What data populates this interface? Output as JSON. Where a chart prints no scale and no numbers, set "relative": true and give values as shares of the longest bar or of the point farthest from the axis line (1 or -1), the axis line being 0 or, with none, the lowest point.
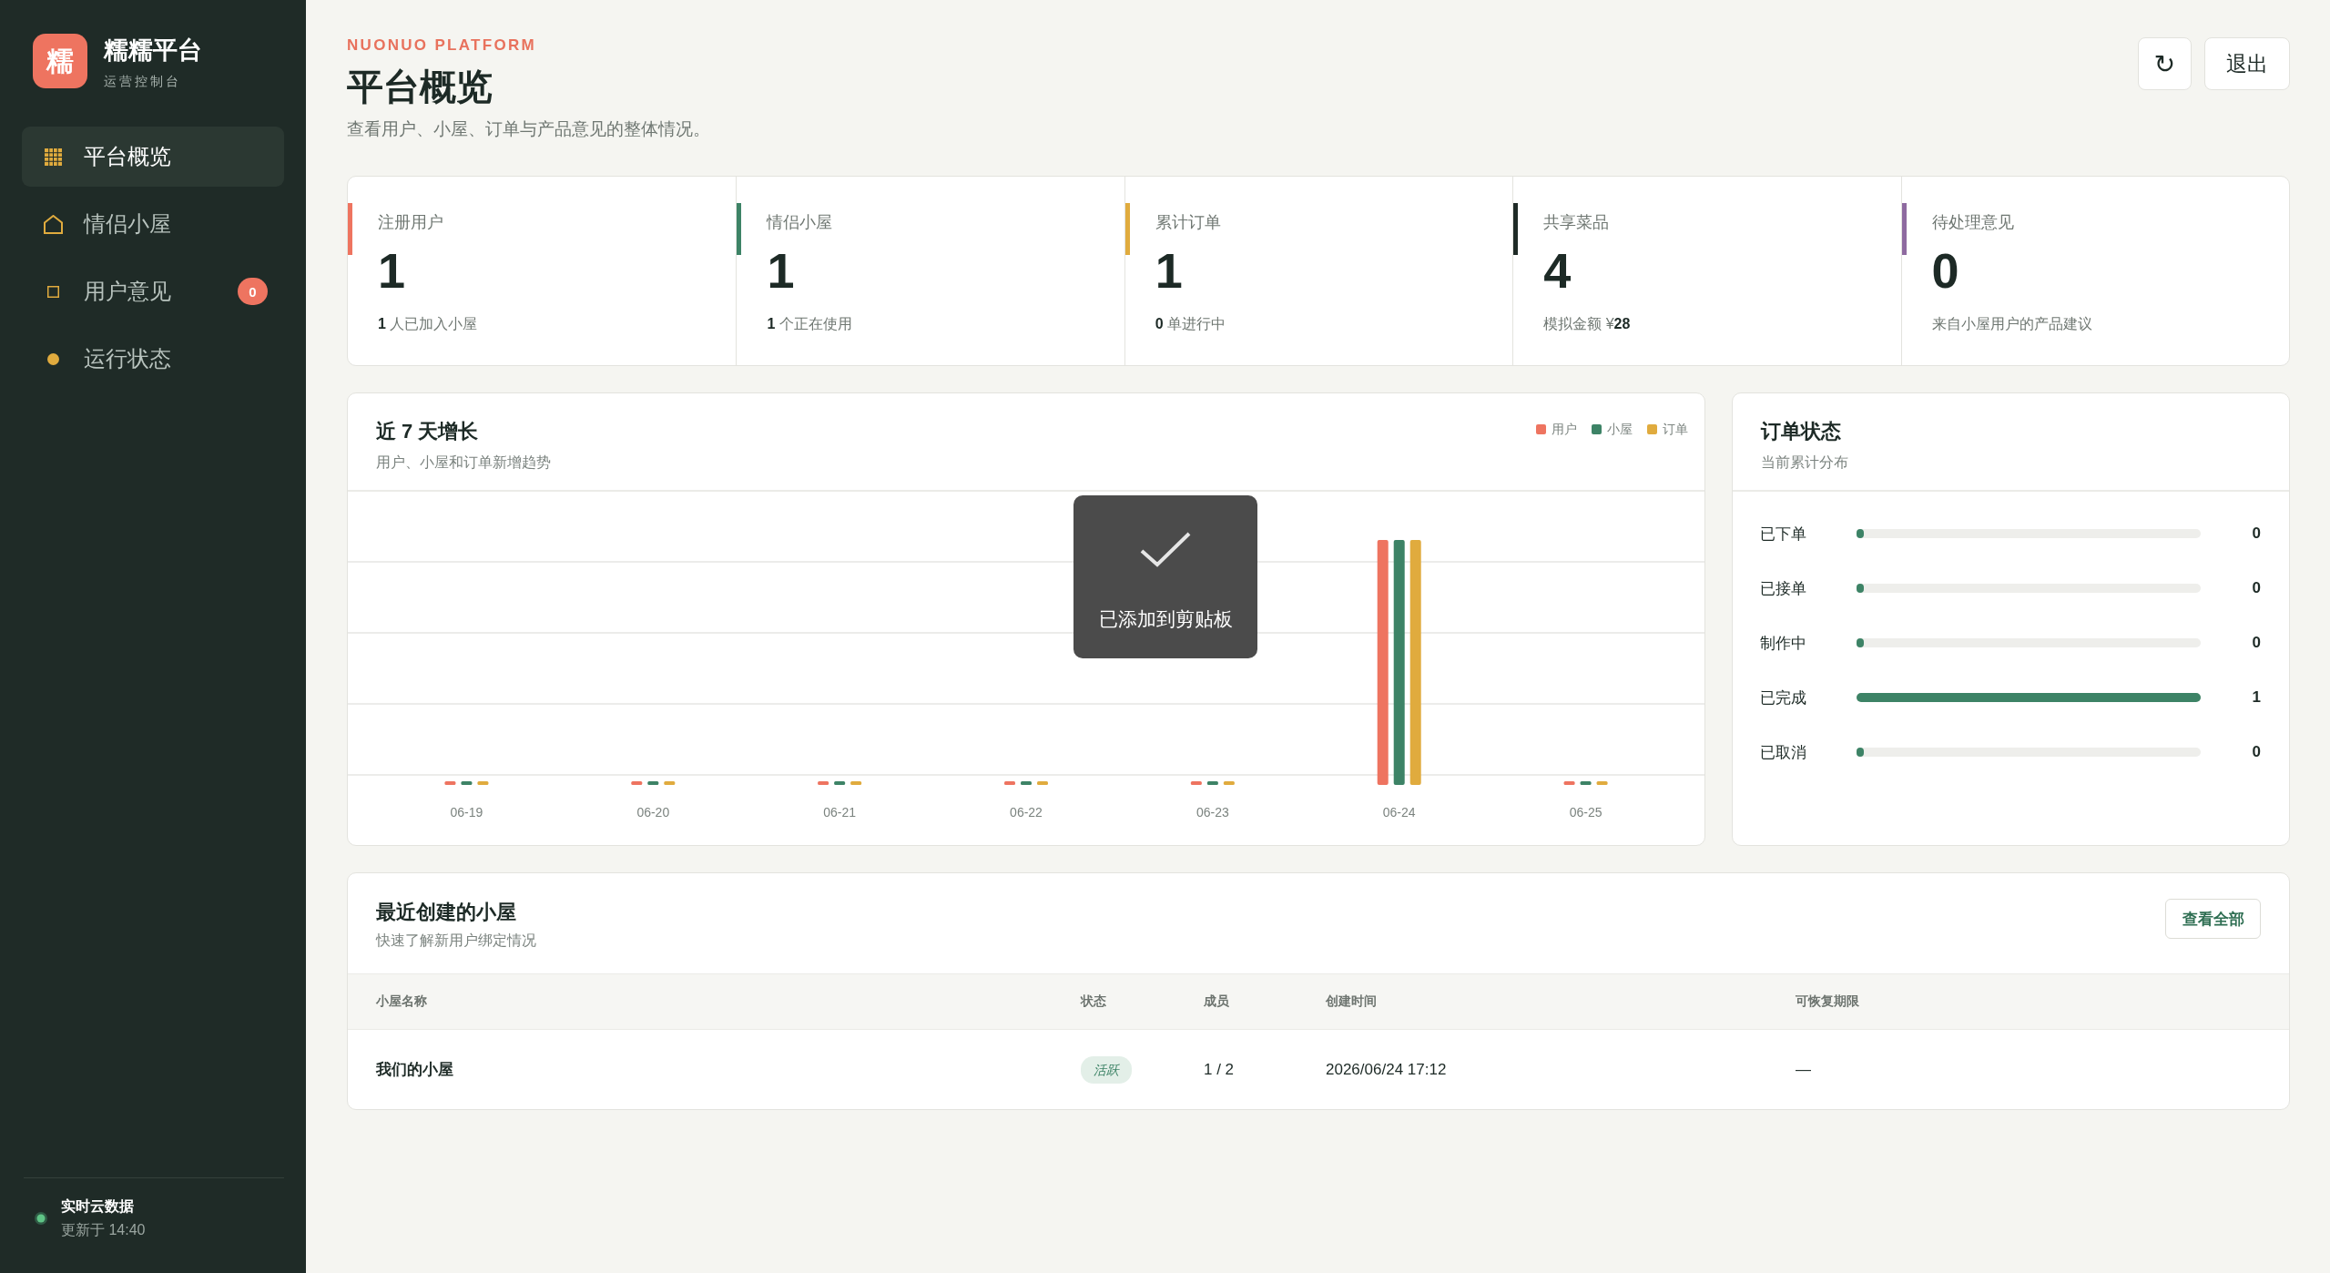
{
  "sidebar": {
    "brand": {
      "logo": "糯",
      "title": "糯糯平台",
      "subtitle": "运营控制台"
    },
    "items": [
      {
        "label": "平台概览",
        "selected": true
      },
      {
        "label": "情侣小屋",
        "selected": false
      },
      {
        "label": "用户意见",
        "selected": false,
        "badge": "0"
      },
      {
        "label": "运行状态",
        "selected": false
      }
    ],
    "status": {
      "title": "实时云数据",
      "updated": "更新于 14:40"
    }
  },
  "header": {
    "eyebrow": "NUONUO PLATFORM",
    "title": "平台概览",
    "subtitle": "查看用户、小屋、订单与产品意见的整体情况。",
    "refresh_button": "↻",
    "logout_button": "退出"
  },
  "stats": [
    {
      "label": "注册用户",
      "value": "1",
      "note": "**1** 人已加入小屋",
      "color": "#ee7460"
    },
    {
      "label": "情侣小屋",
      "value": "1",
      "note": "**1** 个正在使用",
      "color": "#3d8366"
    },
    {
      "label": "累计订单",
      "value": "1",
      "note": "**0** 单进行中",
      "color": "#e0ab3e"
    },
    {
      "label": "共享菜品",
      "value": "4",
      "note": "模拟金额 ¥**28**",
      "color": "#1f2b27"
    },
    {
      "label": "待处理意见",
      "value": "0",
      "note": "来自小屋用户的产品建议",
      "color": "#8e6aa0"
    }
  ],
  "growth_chart": {
    "title": "近 7 天增长",
    "subtitle": "用户、小屋和订单新增趋势",
    "chart_data": {
      "type": "bar",
      "relative": true,
      "categories": [
        "06-19",
        "06-20",
        "06-21",
        "06-22",
        "06-23",
        "06-24",
        "06-25"
      ],
      "series": [
        {
          "name": "用户",
          "color": "#ee7460",
          "values": [
            0,
            0,
            0,
            0,
            0,
            1,
            0
          ]
        },
        {
          "name": "小屋",
          "color": "#3d8366",
          "values": [
            0,
            0,
            0,
            0,
            0,
            1,
            0
          ]
        },
        {
          "name": "订单",
          "color": "#e0ab3e",
          "values": [
            0,
            0,
            0,
            0,
            0,
            1,
            0
          ]
        }
      ]
    }
  },
  "order_status": {
    "title": "订单状态",
    "subtitle": "当前累计分布",
    "rows": [
      {
        "label": "已下单",
        "level": 0,
        "count": "0"
      },
      {
        "label": "已接单",
        "level": 0,
        "count": "0"
      },
      {
        "label": "制作中",
        "level": 0,
        "count": "0"
      },
      {
        "label": "已完成",
        "level": 1,
        "count": "1"
      },
      {
        "label": "已取消",
        "level": 0,
        "count": "0"
      }
    ]
  },
  "recent_houses": {
    "title": "最近创建的小屋",
    "subtitle": "快速了解新用户绑定情况",
    "action": "查看全部",
    "columns": [
      "小屋名称",
      "状态",
      "成员",
      "创建时间",
      "可恢复期限"
    ],
    "rows": [
      {
        "name": "我们的小屋",
        "status": "活跃",
        "members": "1 / 2",
        "created": "2026/06/24 17:12",
        "restore_deadline": "—"
      }
    ]
  },
  "toast": {
    "message": "已添加到剪贴板"
  }
}
